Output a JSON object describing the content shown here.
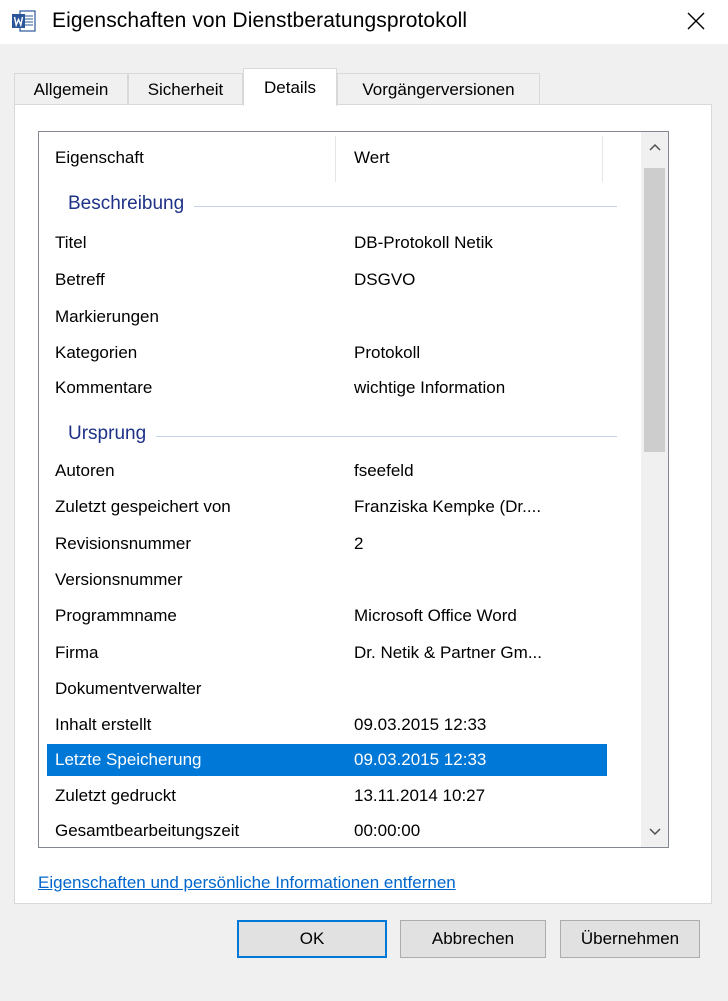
{
  "window": {
    "title": "Eigenschaften von Dienstberatungsprotokoll",
    "close_glyph": "✕",
    "app_icon": "word-document-icon"
  },
  "tabs": [
    {
      "label": "Allgemein",
      "active": false
    },
    {
      "label": "Sicherheit",
      "active": false
    },
    {
      "label": "Details",
      "active": true
    },
    {
      "label": "Vorgängerversionen",
      "active": false
    }
  ],
  "list": {
    "columns": {
      "property": "Eigenschaft",
      "value": "Wert"
    },
    "groups": {
      "description": "Beschreibung",
      "origin": "Ursprung"
    },
    "description_rows": [
      {
        "name": "Titel",
        "value": "DB-Protokoll Netik"
      },
      {
        "name": "Betreff",
        "value": "DSGVO"
      },
      {
        "name": "Markierungen",
        "value": ""
      },
      {
        "name": "Kategorien",
        "value": "Protokoll"
      },
      {
        "name": "Kommentare",
        "value": "wichtige Information"
      }
    ],
    "origin_rows": [
      {
        "name": "Autoren",
        "value": "fseefeld"
      },
      {
        "name": "Zuletzt gespeichert von",
        "value": "Franziska Kempke (Dr...."
      },
      {
        "name": "Revisionsnummer",
        "value": "2"
      },
      {
        "name": "Versionsnummer",
        "value": ""
      },
      {
        "name": "Programmname",
        "value": "Microsoft Office Word"
      },
      {
        "name": "Firma",
        "value": "Dr. Netik & Partner Gm..."
      },
      {
        "name": "Dokumentverwalter",
        "value": ""
      },
      {
        "name": "Inhalt erstellt",
        "value": "09.03.2015 12:33"
      },
      {
        "name": "Letzte Speicherung",
        "value": "09.03.2015 12:33",
        "selected": true
      },
      {
        "name": "Zuletzt gedruckt",
        "value": "13.11.2014 10:27"
      },
      {
        "name": "Gesamtbearbeitungszeit",
        "value": "00:00:00"
      }
    ],
    "scroll_up_glyph": "˄",
    "scroll_down_glyph": "˅"
  },
  "link_text": "Eigenschaften und persönliche Informationen entfernen",
  "buttons": {
    "ok": "OK",
    "cancel": "Abbrechen",
    "apply": "Übernehmen"
  },
  "colors": {
    "selection": "#0078d7",
    "group_title": "#1e3287",
    "link": "#0066cc",
    "word_blue": "#2b579a"
  }
}
